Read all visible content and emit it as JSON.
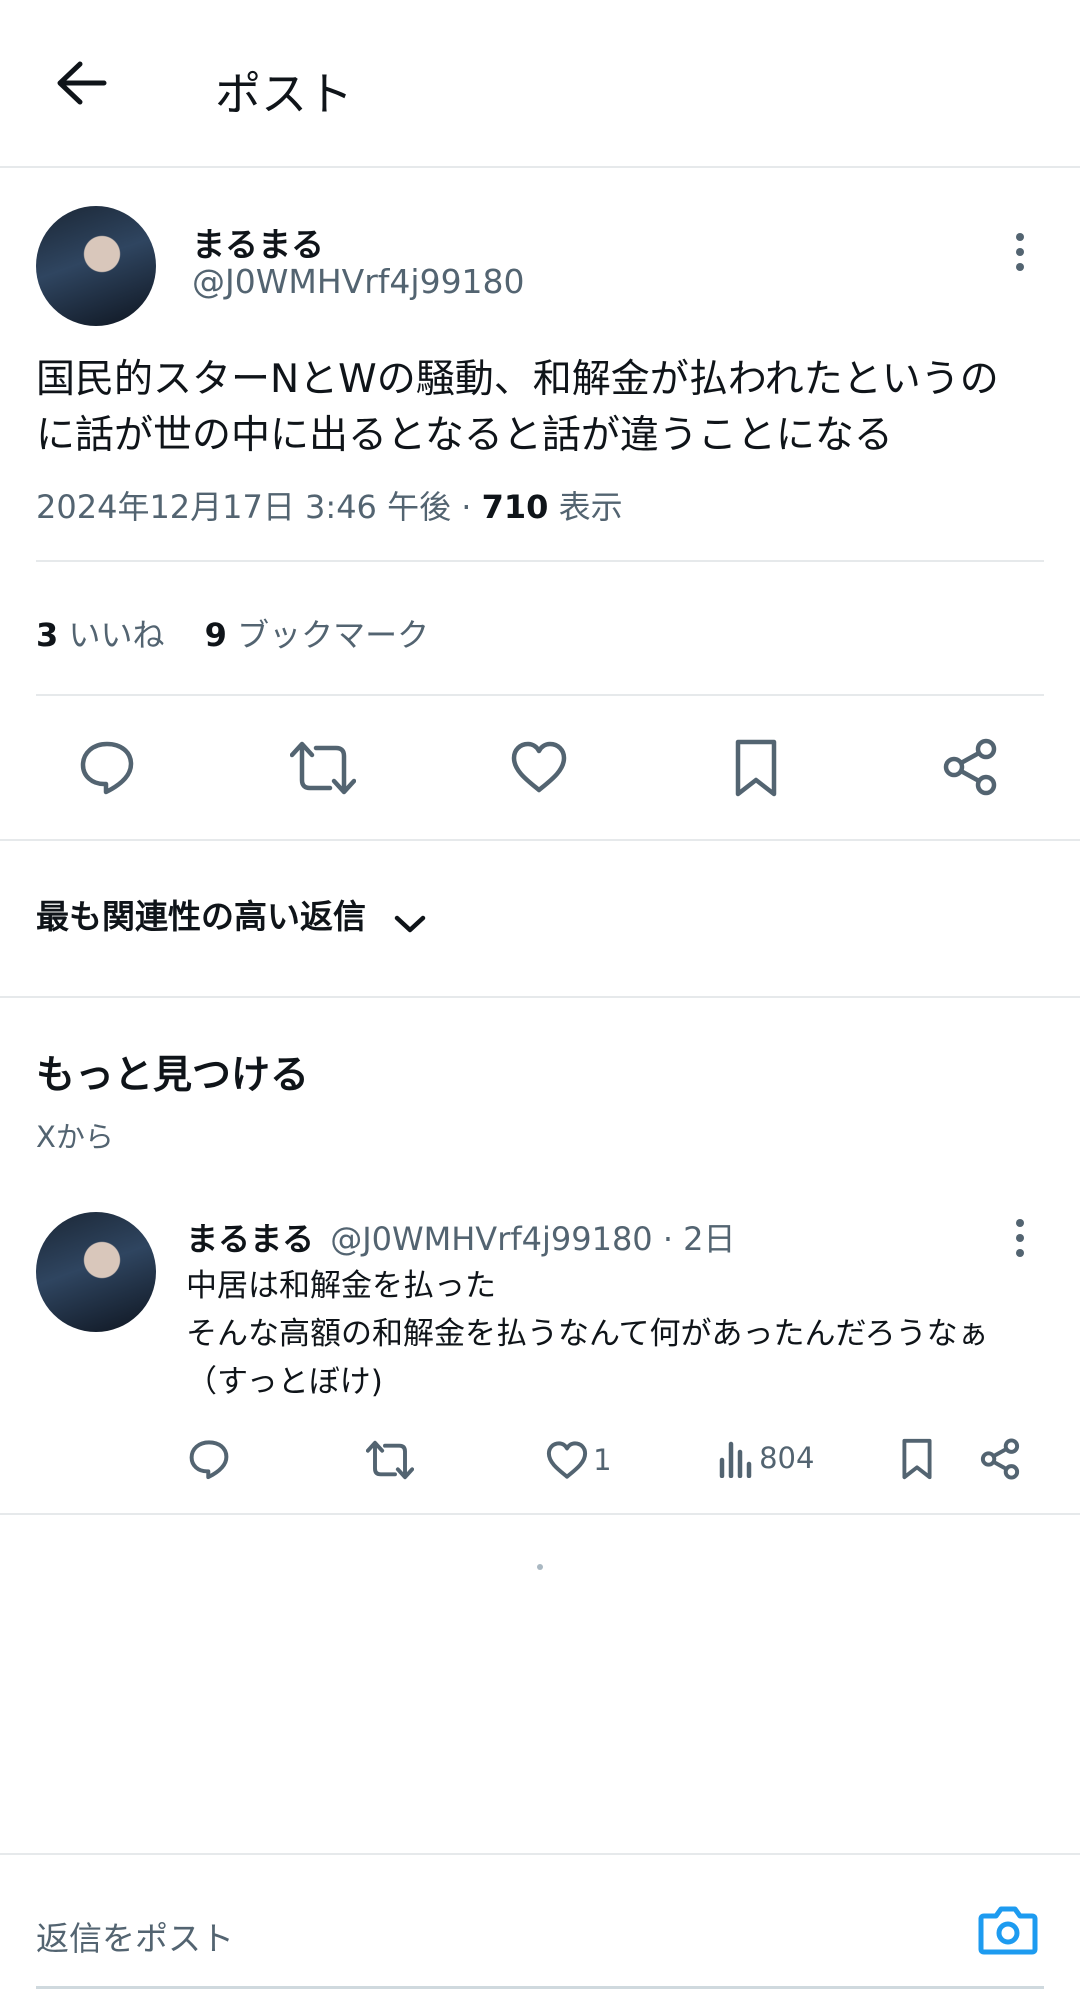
{
  "header": {
    "title": "ポスト"
  },
  "post": {
    "display_name": "まるまる",
    "handle": "@J0WMHVrf4j99180",
    "text_line1": "国民的スターNとWの騒動、和解金が払われたというのに話が世の中に出るとなると話が違うことになる",
    "timestamp": "2024年12月17日 3:46 午後",
    "separator": "·",
    "views_count": "710",
    "views_label": "表示",
    "likes_count": "3",
    "likes_label": "いいね",
    "bookmarks_count": "9",
    "bookmarks_label": "ブックマーク"
  },
  "replies_sort": {
    "label": "最も関連性の高い返信"
  },
  "discover": {
    "title": "もっと見つける",
    "subtitle": "Xから"
  },
  "related_post": {
    "display_name": "まるまる",
    "handle": "@J0WMHVrf4j99180",
    "age": "· 2日",
    "line1": "中居は和解金を払った",
    "line2": "そんな高額の和解金を払うなんて何があったんだろうなぁ（すっとぼけ)",
    "like_count": "1",
    "view_count": "804"
  },
  "reply_bar": {
    "placeholder": "返信をポスト"
  },
  "colors": {
    "accent": "#1d9bf0",
    "muted": "#536471",
    "divider": "#e6e9eb"
  }
}
